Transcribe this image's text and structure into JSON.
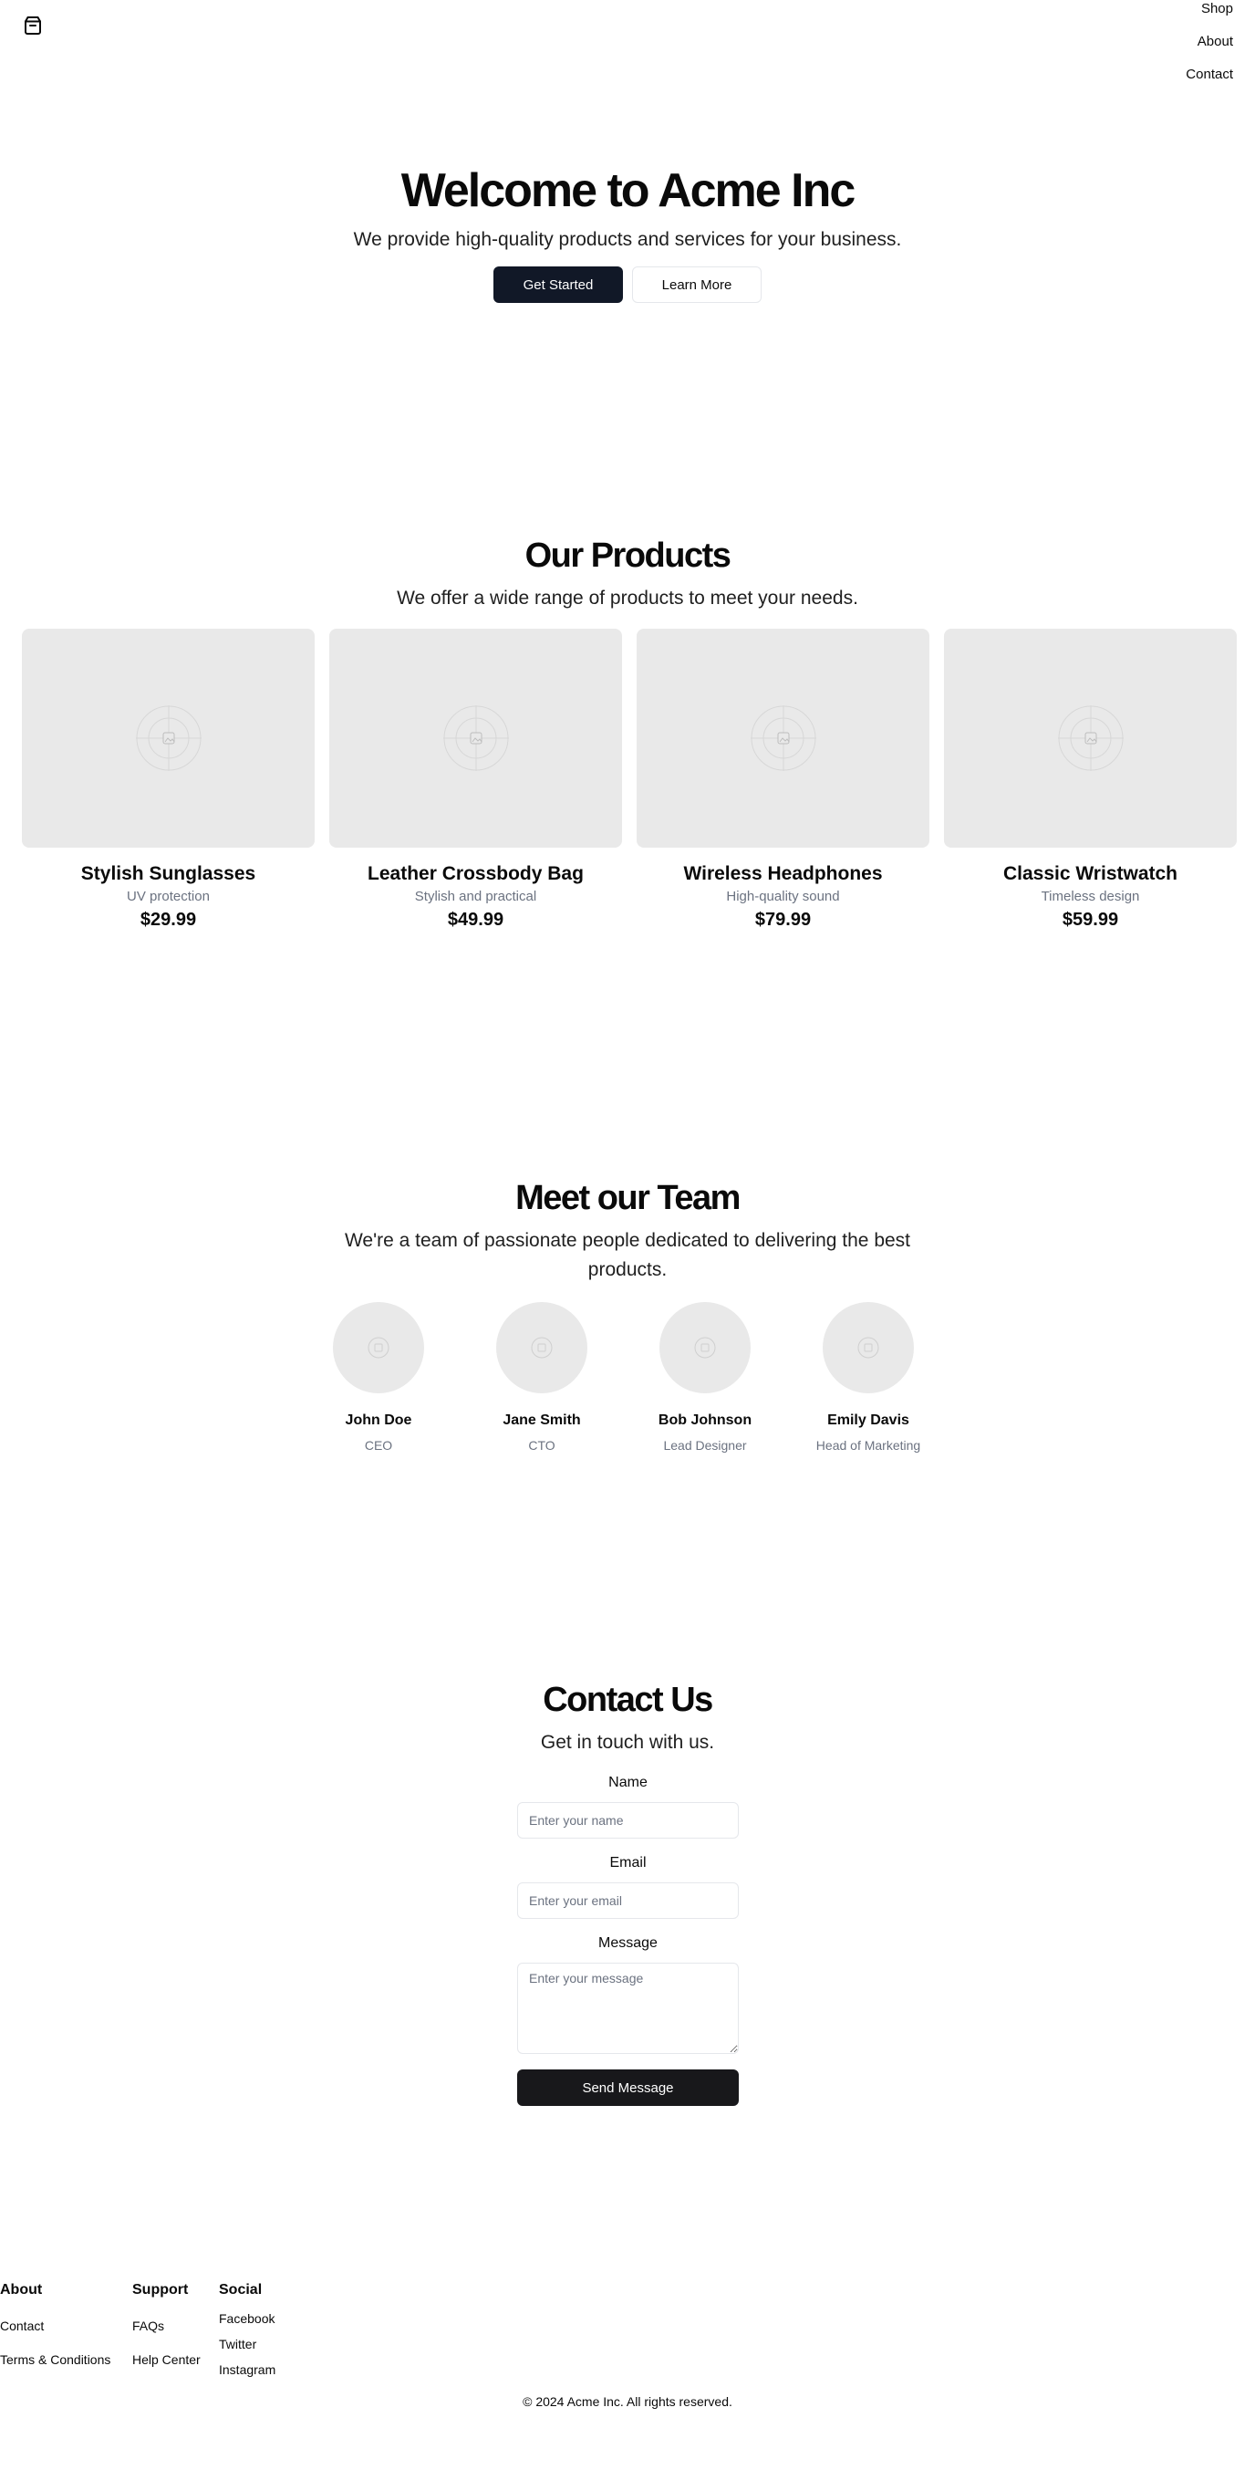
{
  "header": {
    "logo_icon": "package-icon",
    "nav": [
      {
        "label": "Shop"
      },
      {
        "label": "About"
      },
      {
        "label": "Contact"
      }
    ]
  },
  "hero": {
    "title": "Welcome to Acme Inc",
    "subtitle": "We provide high-quality products and services for your business.",
    "primary_button": "Get Started",
    "secondary_button": "Learn More"
  },
  "products": {
    "title": "Our Products",
    "subtitle": "We offer a wide range of products to meet your needs.",
    "items": [
      {
        "name": "Stylish Sunglasses",
        "description": "UV protection",
        "price": "$29.99",
        "image_icon": "placeholder-image-icon"
      },
      {
        "name": "Leather Crossbody Bag",
        "description": "Stylish and practical",
        "price": "$49.99",
        "image_icon": "placeholder-image-icon"
      },
      {
        "name": "Wireless Headphones",
        "description": "High-quality sound",
        "price": "$79.99",
        "image_icon": "placeholder-image-icon"
      },
      {
        "name": "Classic Wristwatch",
        "description": "Timeless design",
        "price": "$59.99",
        "image_icon": "placeholder-image-icon"
      }
    ]
  },
  "team": {
    "title": "Meet our Team",
    "subtitle": "We're a team of passionate people dedicated to delivering the best products.",
    "members": [
      {
        "name": "John Doe",
        "role": "CEO"
      },
      {
        "name": "Jane Smith",
        "role": "CTO"
      },
      {
        "name": "Bob Johnson",
        "role": "Lead Designer"
      },
      {
        "name": "Emily Davis",
        "role": "Head of Marketing"
      }
    ]
  },
  "contact": {
    "title": "Contact Us",
    "subtitle": "Get in touch with us.",
    "name_label": "Name",
    "name_placeholder": "Enter your name",
    "email_label": "Email",
    "email_placeholder": "Enter your email",
    "message_label": "Message",
    "message_placeholder": "Enter your message",
    "submit_label": "Send Message"
  },
  "footer": {
    "about": {
      "heading": "About",
      "links": [
        "Contact",
        "Terms & Conditions"
      ]
    },
    "support": {
      "heading": "Support",
      "links": [
        "FAQs",
        "Help Center"
      ]
    },
    "social": {
      "heading": "Social",
      "links": [
        "Facebook",
        "Twitter",
        "Instagram"
      ]
    },
    "copyright": "© 2024 Acme Inc. All rights reserved."
  },
  "colors": {
    "primary_button": "#111827",
    "send_button": "#18181b",
    "placeholder_bg": "#e9e9e9",
    "muted_text": "#6b7280"
  }
}
